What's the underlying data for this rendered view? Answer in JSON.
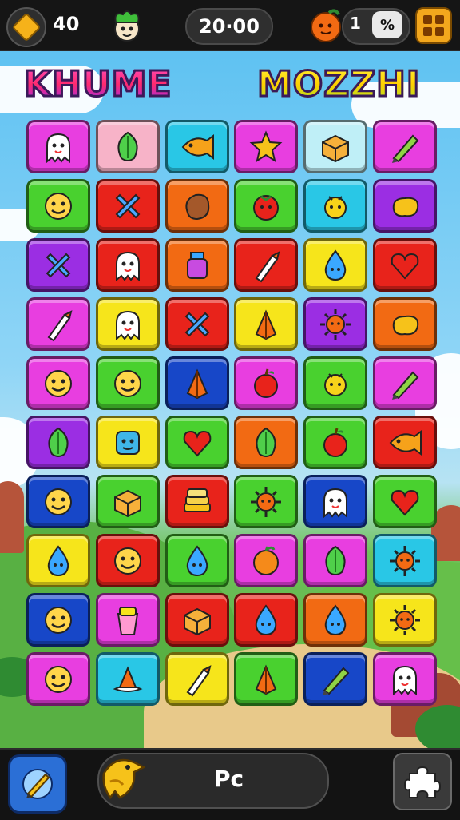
{
  "header": {
    "coins_value": "40",
    "coin_icon": "gold-diamond-icon",
    "mascot_icon": "green-haired-mascot-icon",
    "timer_value": "20·00",
    "fruit_icon": "orange-fruit-icon",
    "lives_value": "1",
    "percent_label": "%",
    "menu_icon": "grid-menu-icon"
  },
  "titles": {
    "left": "KHUME",
    "right": "MOZZHI"
  },
  "board": {
    "rows": [
      [
        {
          "color": "#e83ee0",
          "icon": "ghost"
        },
        {
          "color": "#f7b3c8",
          "icon": "leaf"
        },
        {
          "color": "#29c7e6",
          "icon": "fish"
        },
        {
          "color": "#e83ee0",
          "icon": "star"
        },
        {
          "color": "#bfeff7",
          "icon": "box"
        },
        {
          "color": "#e83ee0",
          "icon": "pencil"
        }
      ],
      [
        {
          "color": "#49d12f",
          "icon": "smile"
        },
        {
          "color": "#e8231b",
          "icon": "cross"
        },
        {
          "color": "#f26a13",
          "icon": "potato"
        },
        {
          "color": "#49d12f",
          "icon": "tomato"
        },
        {
          "color": "#29c7e6",
          "icon": "bug"
        },
        {
          "color": "#9b2ee3",
          "icon": "blob"
        }
      ],
      [
        {
          "color": "#9b2ee3",
          "icon": "cross"
        },
        {
          "color": "#e8231b",
          "icon": "ghost"
        },
        {
          "color": "#f26a13",
          "icon": "jar"
        },
        {
          "color": "#e8231b",
          "icon": "brush"
        },
        {
          "color": "#f6e51b",
          "icon": "drop"
        },
        {
          "color": "#e8231b",
          "icon": "heart"
        }
      ],
      [
        {
          "color": "#e83ee0",
          "icon": "brush"
        },
        {
          "color": "#f6e51b",
          "icon": "ghost"
        },
        {
          "color": "#e8231b",
          "icon": "cross"
        },
        {
          "color": "#f6e51b",
          "icon": "crystal"
        },
        {
          "color": "#9b2ee3",
          "icon": "sun"
        },
        {
          "color": "#f26a13",
          "icon": "blob"
        }
      ],
      [
        {
          "color": "#e83ee0",
          "icon": "smile"
        },
        {
          "color": "#49d12f",
          "icon": "smile"
        },
        {
          "color": "#1747c8",
          "icon": "crystal"
        },
        {
          "color": "#e83ee0",
          "icon": "apple"
        },
        {
          "color": "#49d12f",
          "icon": "bug"
        },
        {
          "color": "#e83ee0",
          "icon": "pencil"
        }
      ],
      [
        {
          "color": "#9b2ee3",
          "icon": "leaf"
        },
        {
          "color": "#f6e51b",
          "icon": "cube"
        },
        {
          "color": "#49d12f",
          "icon": "heart"
        },
        {
          "color": "#f26a13",
          "icon": "leaf"
        },
        {
          "color": "#49d12f",
          "icon": "apple"
        },
        {
          "color": "#e8231b",
          "icon": "fish"
        }
      ],
      [
        {
          "color": "#1747c8",
          "icon": "smile"
        },
        {
          "color": "#49d12f",
          "icon": "box"
        },
        {
          "color": "#e8231b",
          "icon": "stack"
        },
        {
          "color": "#49d12f",
          "icon": "sun"
        },
        {
          "color": "#1747c8",
          "icon": "ghost"
        },
        {
          "color": "#49d12f",
          "icon": "heart"
        }
      ],
      [
        {
          "color": "#f6e51b",
          "icon": "drop"
        },
        {
          "color": "#e8231b",
          "icon": "smile"
        },
        {
          "color": "#49d12f",
          "icon": "drop"
        },
        {
          "color": "#e83ee0",
          "icon": "orange"
        },
        {
          "color": "#e83ee0",
          "icon": "leaf"
        },
        {
          "color": "#29c7e6",
          "icon": "sun"
        }
      ],
      [
        {
          "color": "#1747c8",
          "icon": "smile"
        },
        {
          "color": "#e83ee0",
          "icon": "cup"
        },
        {
          "color": "#e8231b",
          "icon": "box"
        },
        {
          "color": "#e8231b",
          "icon": "drop"
        },
        {
          "color": "#f26a13",
          "icon": "drop"
        },
        {
          "color": "#f6e51b",
          "icon": "sun"
        }
      ],
      [
        {
          "color": "#e83ee0",
          "icon": "smile"
        },
        {
          "color": "#29c7e6",
          "icon": "hat"
        },
        {
          "color": "#f6e51b",
          "icon": "brush"
        },
        {
          "color": "#49d12f",
          "icon": "crystal"
        },
        {
          "color": "#1747c8",
          "icon": "pencil"
        },
        {
          "color": "#e83ee0",
          "icon": "ghost"
        }
      ]
    ]
  },
  "footer": {
    "left_icon": "blue-pencil-button-icon",
    "bird_icon": "yellow-bird-icon",
    "progress_label": "Pᴄ",
    "right_icon": "puzzle-piece-icon"
  }
}
